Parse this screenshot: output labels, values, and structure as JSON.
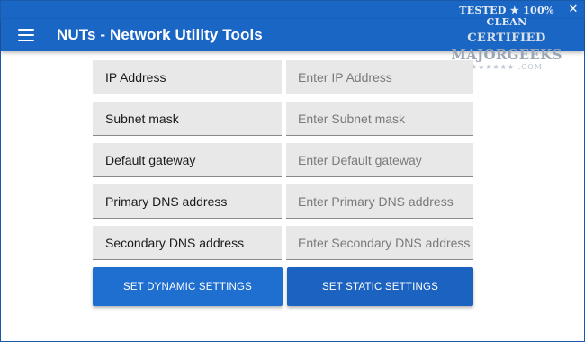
{
  "window": {
    "close_glyph": "✕"
  },
  "appbar": {
    "menu_icon": "hamburger-menu-icon",
    "title": "NUTs - Network Utility Tools"
  },
  "form": {
    "rows": [
      {
        "label": "IP Address",
        "placeholder": "Enter IP Address",
        "value": ""
      },
      {
        "label": "Subnet mask",
        "placeholder": "Enter Subnet mask",
        "value": ""
      },
      {
        "label": "Default gateway",
        "placeholder": "Enter Default gateway",
        "value": ""
      },
      {
        "label": "Primary DNS address",
        "placeholder": "Enter Primary DNS address",
        "value": ""
      },
      {
        "label": "Secondary DNS address",
        "placeholder": "Enter Secondary DNS address",
        "value": ""
      }
    ]
  },
  "buttons": {
    "dynamic": "SET DYNAMIC SETTINGS",
    "static": "SET STATIC SETTINGS"
  },
  "watermark": {
    "top": "TESTED ★ 100% CLEAN",
    "certified": "CERTIFIED",
    "brand": "MAJORGEEKS",
    "domain": "★★★★★★ .COM"
  },
  "colors": {
    "appbar": "#1a66c4",
    "button_dynamic": "#1f6fd0",
    "button_static": "#1c62c0",
    "field_bg": "#e8e8e8"
  }
}
